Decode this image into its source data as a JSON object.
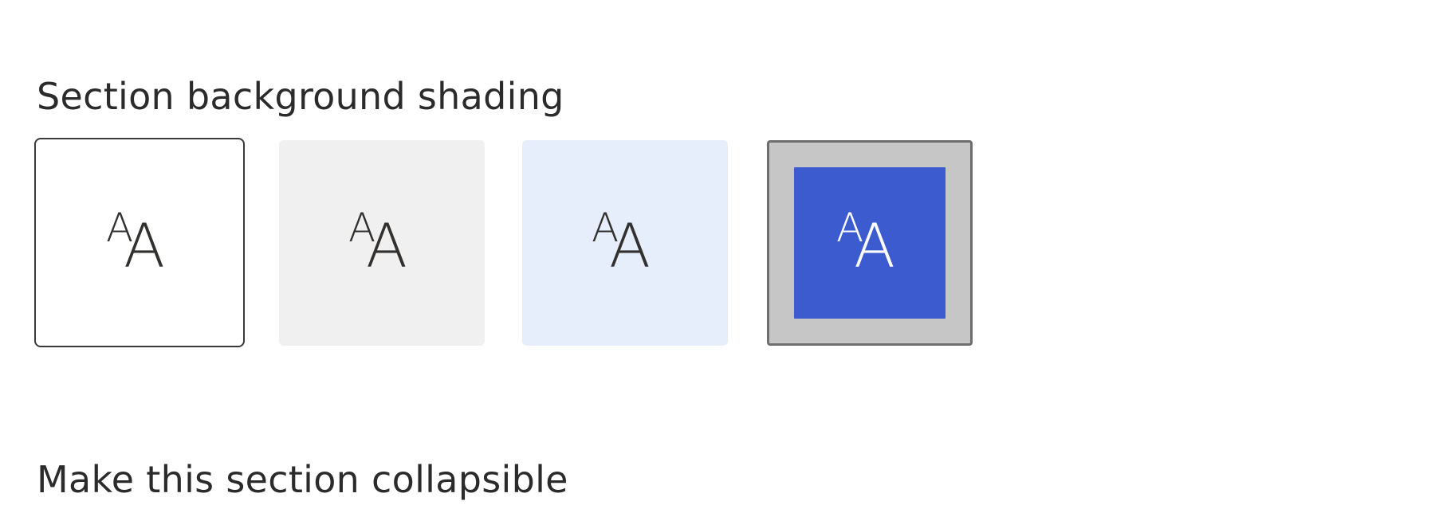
{
  "shading": {
    "label": "Section background shading",
    "options": [
      {
        "id": "none",
        "glyph_small": "A",
        "glyph_large": "A",
        "background": "#ffffff",
        "text_color": "#323130",
        "selected": true
      },
      {
        "id": "neutral",
        "glyph_small": "A",
        "glyph_large": "A",
        "background": "#f0f0f0",
        "text_color": "#323130",
        "selected": false
      },
      {
        "id": "soft",
        "glyph_small": "A",
        "glyph_large": "A",
        "background": "#e6eefc",
        "text_color": "#323130",
        "selected": false
      },
      {
        "id": "strong",
        "glyph_small": "A",
        "glyph_large": "A",
        "background": "#3b5bcf",
        "text_color": "#ffffff",
        "selected": false
      }
    ]
  },
  "collapsible": {
    "label": "Make this section collapsible"
  }
}
